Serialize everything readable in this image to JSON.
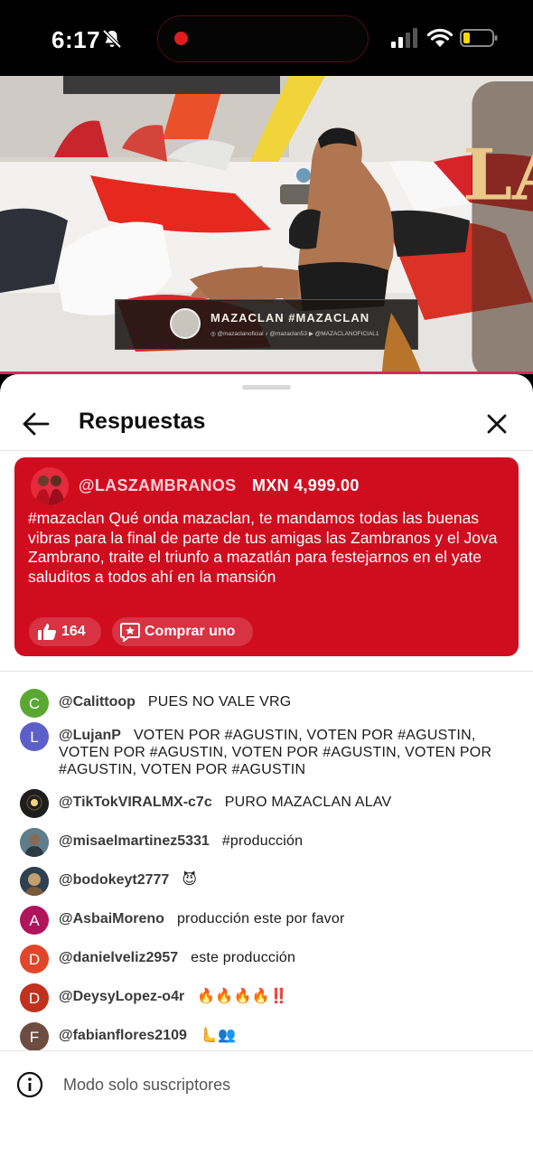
{
  "status_bar": {
    "time": "6:17",
    "icons": [
      "bell-off-icon",
      "recording-dot-icon",
      "signal-icon",
      "wifi-icon",
      "battery-low-icon"
    ]
  },
  "video": {
    "logo_text": "LA MANSIÓN VIP",
    "lower_third_title": "MAZACLAN #MAZACLAN",
    "lower_third_socials": "◎ @mazaclanoficial   ♪ @mazaclan53   ▶ @MAZACLANOFICIAL1"
  },
  "sheet": {
    "title": "Respuestas"
  },
  "superchat": {
    "user": "@LASZAMBRANOS",
    "amount": "MXN 4,999.00",
    "text": "#mazaclan Qué onda mazaclan, te mandamos todas las buenas vibras para la final de parte de tus amigas las Zambranos y el Jova Zambrano, traite el triunfo a mazatlán para festejarnos en el yate saluditos a todos ahí en la mansión",
    "likes": "164",
    "buy_label": "Comprar uno",
    "color": "#d00d1f"
  },
  "messages": [
    {
      "avatar_letter": "C",
      "avatar_color": "#5aa832",
      "user": "@Calittoop",
      "text": "PUES NO VALE VRG"
    },
    {
      "avatar_letter": "L",
      "avatar_color": "#5c5fc8",
      "user": "@LujanP",
      "text": "VOTEN POR #AGUSTIN, VOTEN POR #AGUSTIN, VOTEN POR #AGUSTIN, VOTEN POR #AGUSTIN, VOTEN POR #AGUSTIN, VOTEN POR #AGUSTIN"
    },
    {
      "avatar_letter": "",
      "avatar_color": "#1e1e1e",
      "user": "@TikTokVIRALMX-c7c",
      "text": "PURO MAZACLAN ALAV"
    },
    {
      "avatar_letter": "",
      "avatar_color": "#4e6a7a",
      "user": "@misaelmartinez5331",
      "text": "#producción"
    },
    {
      "avatar_letter": "",
      "avatar_color": "#3b4a5a",
      "user": "@bodokeyt2777",
      "text": "😈"
    },
    {
      "avatar_letter": "A",
      "avatar_color": "#b0145a",
      "user": "@AsbaiMoreno",
      "text": "producción este por favor"
    },
    {
      "avatar_letter": "D",
      "avatar_color": "#e0462a",
      "user": "@danielveliz2957",
      "text": "este producción"
    },
    {
      "avatar_letter": "D",
      "avatar_color": "#c0321e",
      "user": "@DeysyLopez-o4r",
      "text": "🔥🔥🔥🔥‼️"
    },
    {
      "avatar_letter": "F",
      "avatar_color": "#6d4c41",
      "user": "@fabianflores2109",
      "text": "🫷👥"
    }
  ],
  "footer": {
    "text": "Modo solo suscriptores"
  }
}
